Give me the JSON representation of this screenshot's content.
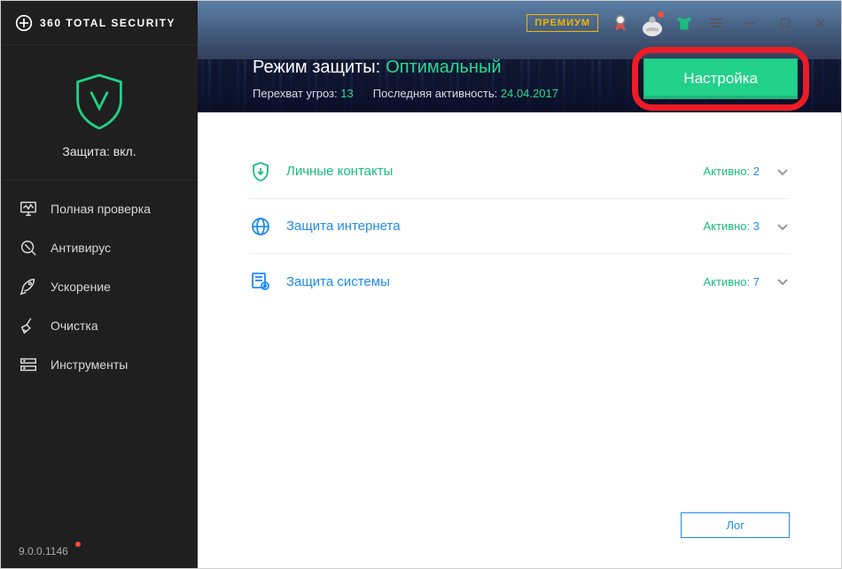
{
  "app": {
    "title": "360 TOTAL SECURITY",
    "version": "9.0.0.1146"
  },
  "topbar": {
    "premium_label": "ПРЕМИУМ"
  },
  "sidebar": {
    "protection_label": "Защита: вкл.",
    "items": [
      {
        "label": "Полная проверка"
      },
      {
        "label": "Антивирус"
      },
      {
        "label": "Ускорение"
      },
      {
        "label": "Очистка"
      },
      {
        "label": "Инструменты"
      }
    ]
  },
  "banner": {
    "mode_label": "Режим защиты:",
    "mode_value": "Оптимальный",
    "threats_label": "Перехват угроз:",
    "threats_value": "13",
    "activity_label": "Последняя активность:",
    "activity_value": "24.04.2017",
    "settings_button": "Настройка"
  },
  "sections": [
    {
      "label": "Личные контакты",
      "status_label": "Активно:",
      "count": "2"
    },
    {
      "label": "Защита интернета",
      "status_label": "Активно:",
      "count": "3"
    },
    {
      "label": "Защита системы",
      "status_label": "Активно:",
      "count": "7"
    }
  ],
  "log_button": "Лог"
}
